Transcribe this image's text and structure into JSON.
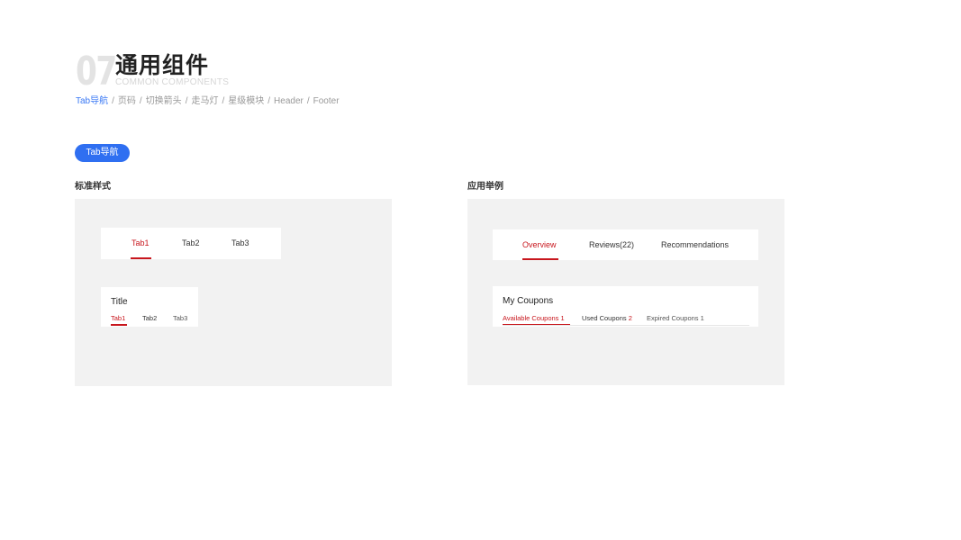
{
  "header": {
    "section_number": "07",
    "title": "通用组件",
    "subtitle": "COMMON COMPONENTS",
    "breadcrumb": [
      "Tab导航",
      "页码",
      "切换箭头",
      "走马灯",
      "星级模块",
      "Header",
      "Footer"
    ],
    "separator": "/"
  },
  "pill_label": "Tab导航",
  "standard": {
    "caption": "标准样式",
    "tab_bar": {
      "tabs": [
        "Tab1",
        "Tab2",
        "Tab3"
      ],
      "active_index": 0
    },
    "titled_card": {
      "title": "Title",
      "tabs": [
        "Tab1",
        "Tab2",
        "Tab3"
      ],
      "active_index": 0
    }
  },
  "example": {
    "caption": "应用举例",
    "tab_bar": {
      "tabs": [
        "Overview",
        "Reviews(22)",
        "Recommendations"
      ],
      "active_index": 0
    },
    "coupons": {
      "title": "My Coupons",
      "tabs": [
        {
          "label": "Available Coupons",
          "count": "1"
        },
        {
          "label": "Used Coupons",
          "count": "2"
        },
        {
          "label": "Expired Coupons",
          "count": "1"
        }
      ],
      "active_index": 0
    }
  },
  "colors": {
    "accent_red": "#c8161d",
    "pill_blue": "#2f6ff1",
    "breadcrumb_active": "#3a79f5",
    "panel_bg": "#f2f2f2"
  }
}
